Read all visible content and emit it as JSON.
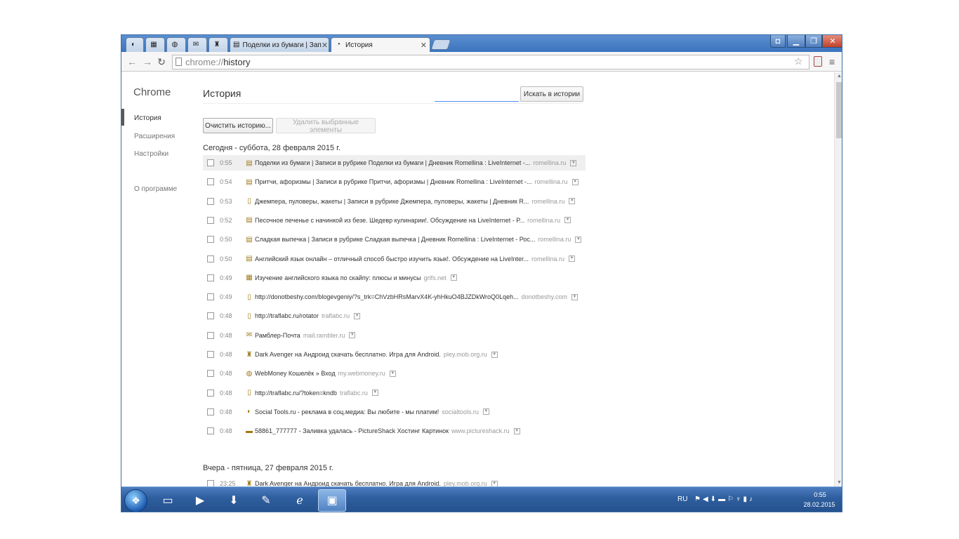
{
  "tabs": [
    {
      "icon": "settings-icon",
      "glyph": "◐",
      "pinned": true
    },
    {
      "icon": "picture-icon",
      "glyph": "▦",
      "pinned": true
    },
    {
      "icon": "globe-icon",
      "glyph": "◍",
      "pinned": true
    },
    {
      "icon": "mail-icon",
      "glyph": "✉",
      "pinned": true
    },
    {
      "icon": "game-icon",
      "glyph": "♜",
      "pinned": true
    },
    {
      "icon": "liveinternet-icon",
      "glyph": "▤",
      "pinned": false,
      "title": "Поделки из бумаги | Зап"
    },
    {
      "icon": "history-icon",
      "glyph": "◔",
      "pinned": false,
      "title": "История",
      "active": true
    }
  ],
  "omnibox": {
    "scheme": "chrome://",
    "path": "history"
  },
  "sidebar": {
    "title": "Chrome",
    "items": [
      "История",
      "Расширения",
      "Настройки",
      "О программе"
    ]
  },
  "main": {
    "title": "История",
    "search_placeholder": "",
    "search_button": "Искать в истории",
    "clear_button": "Очистить историю...",
    "remove_button": "Удалить выбранные элементы",
    "today_heading": "Сегодня - суббота, 28 февраля 2015 г.",
    "yesterday_heading": "Вчера - пятница, 27 февраля 2015 г."
  },
  "history_today": [
    {
      "time": "0:55",
      "icon": "liveinternet-icon",
      "title": "Поделки из бумаги | Записи в рубрике Поделки из бумаги | Дневник Romellina : LiveInternet -...",
      "domain": "romellina.ru"
    },
    {
      "time": "0:54",
      "icon": "liveinternet-icon",
      "title": "Притчи, афоризмы | Записи в рубрике Притчи, афоризмы | Дневник Romellina : LiveInternet -...",
      "domain": "romellina.ru"
    },
    {
      "time": "0:53",
      "icon": "page-icon",
      "title": "Джемпера, пуловеры, жакеты | Записи в рубрике Джемпера, пуловеры, жакеты | Дневник R...",
      "domain": "romellina.ru"
    },
    {
      "time": "0:52",
      "icon": "liveinternet-icon",
      "title": "Песочное печенье с начинкой из безе. Шедевр кулинарии!. Обсуждение на LiveInternet - Р...",
      "domain": "romellina.ru"
    },
    {
      "time": "0:50",
      "icon": "liveinternet-icon",
      "title": "Сладкая выпечка | Записи в рубрике Сладкая выпечка | Дневник Romellina : LiveInternet - Рос...",
      "domain": "romellina.ru"
    },
    {
      "time": "0:50",
      "icon": "liveinternet-icon",
      "title": "Английский язык онлайн – отличный способ быстро изучить язык!. Обсуждение на LiveInter...",
      "domain": "romellina.ru"
    },
    {
      "time": "0:49",
      "icon": "site-icon",
      "title": "Изучение английского языка по скайпу: плюсы и минусы",
      "domain": "grifs.net"
    },
    {
      "time": "0:49",
      "icon": "page-icon",
      "title": "http://donotbeshy.com/blogevgeniy/?s_trk=ChVzbHRsMarvX4K-yhHkuO4BJZDkWroQ0Lqeh...",
      "domain": "donotbeshy.com"
    },
    {
      "time": "0:48",
      "icon": "page-icon",
      "title": "http://traflabc.ru/rotator",
      "domain": "traflabc.ru"
    },
    {
      "time": "0:48",
      "icon": "mail-icon",
      "title": "Рамблер-Почта",
      "domain": "mail.rambler.ru"
    },
    {
      "time": "0:48",
      "icon": "game-icon",
      "title": "Dark Avenger на Андроид скачать бесплатно. Игра для Android.",
      "domain": "pley.mob.org.ru"
    },
    {
      "time": "0:48",
      "icon": "globe-icon",
      "title": "WebMoney Кошелёк » Вход",
      "domain": "my.webmoney.ru"
    },
    {
      "time": "0:48",
      "icon": "page-icon",
      "title": "http://traflabc.ru/?token=kndb",
      "domain": "traflabc.ru"
    },
    {
      "time": "0:48",
      "icon": "settings-icon",
      "title": "Social Tools.ru - реклама в соц.медиа: Вы любите - мы платим!",
      "domain": "socialtools.ru"
    },
    {
      "time": "0:48",
      "icon": "picture-icon",
      "title": "58861_777777 - Заливка удалась - PictureShack Хостинг Картинок",
      "domain": "www.pictureshack.ru"
    }
  ],
  "history_yesterday": [
    {
      "time": "23:25",
      "icon": "game-icon",
      "title": "Dark Avenger на Андроид скачать бесплатно. Игра для Android.",
      "domain": "pley.mob.org.ru"
    }
  ],
  "taskbar": {
    "apps": [
      "explorer-icon",
      "media-player-icon",
      "torrent-icon",
      "paint-icon",
      "internet-explorer-icon",
      "chrome-window-icon"
    ],
    "lang": "RU",
    "time": "0:55",
    "date": "28.02.2015"
  }
}
